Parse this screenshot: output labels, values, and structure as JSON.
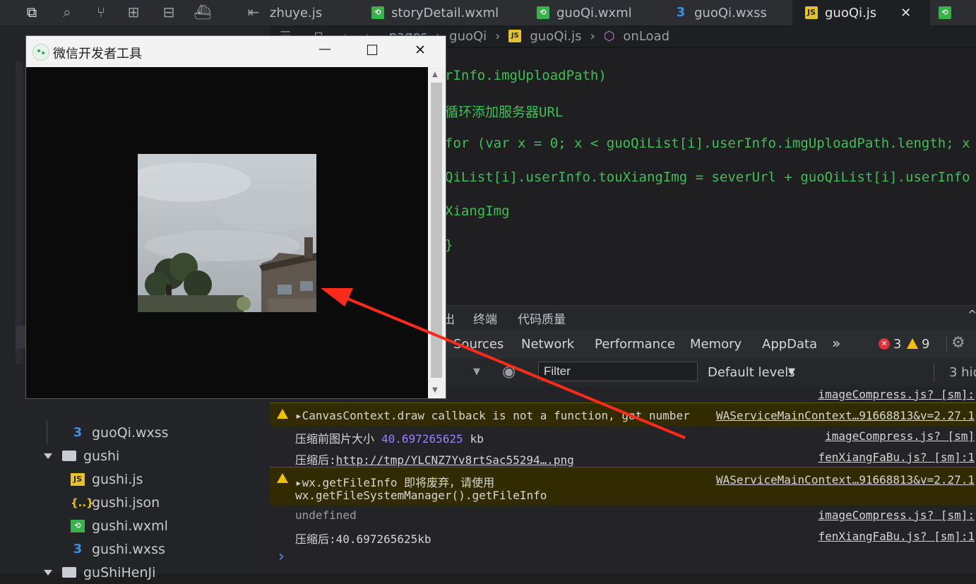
{
  "tabs": [
    {
      "label": "zhuye.js",
      "icon": "js"
    },
    {
      "label": "storyDetail.wxml",
      "icon": "wxml"
    },
    {
      "label": "guoQi.wxml",
      "icon": "wxml"
    },
    {
      "label": "guoQi.wxss",
      "icon": "wxss"
    },
    {
      "label": "guoQi.js",
      "icon": "js",
      "active": true
    }
  ],
  "close_glyph": "✕",
  "breadcrumb": [
    "pages",
    "guoQi",
    "guoQi.js",
    "onLoad"
  ],
  "code_lines": [
    "rInfo.imgUploadPath)",
    "循环添加服务器URL",
    "for (var x = 0; x < guoQiList[i].userInfo.imgUploadPath.length; x",
    "QiList[i].userInfo.touXiangImg = severUrl + guoQiList[i].userInfo",
    "XiangImg",
    "}"
  ],
  "sidebar": [
    {
      "label": "guoQi.wxss",
      "type": "wxss",
      "indent": 2
    },
    {
      "label": "gushi",
      "type": "folder",
      "indent": 1
    },
    {
      "label": "gushi.js",
      "type": "js",
      "indent": 2
    },
    {
      "label": "gushi.json",
      "type": "json",
      "indent": 2
    },
    {
      "label": "gushi.wxml",
      "type": "wxml",
      "indent": 2
    },
    {
      "label": "gushi.wxss",
      "type": "wxss",
      "indent": 2
    },
    {
      "label": "guShiHenJi",
      "type": "folder",
      "indent": 1
    }
  ],
  "panel_tabs": [
    "出",
    "终端",
    "代码质量"
  ],
  "devtools_tabs": [
    "Sources",
    "Network",
    "Performance",
    "Memory",
    "AppData"
  ],
  "more_glyph": "»",
  "error_count": "3",
  "warning_count": "9",
  "filter_placeholder": "Filter",
  "levels_label": "Default levels",
  "hidden_label": "3 hid",
  "console": [
    {
      "type": "log",
      "msg": "",
      "src": "imageCompress.js? [sm]:"
    },
    {
      "type": "warn",
      "msg": "▸CanvasContext.draw callback is not a function, got number",
      "src": "WAServiceMainContext…91668813&v=2.27.1"
    },
    {
      "type": "log",
      "msg": "压缩前图片大小",
      "num": "40.697265625",
      "suffix": "kb",
      "src": "imageCompress.js? [sm]"
    },
    {
      "type": "log",
      "msg": "压缩后:",
      "link": "http://tmp/YLCNZ7Yv8rtSac55294….png",
      "src": "fenXiangFaBu.js? [sm]:1"
    },
    {
      "type": "warn",
      "msg": "▸wx.getFileInfo 即将废弃，请使用",
      "msg2": "wx.getFileSystemManager().getFileInfo",
      "src": "WAServiceMainContext…91668813&v=2.27.1"
    },
    {
      "type": "log",
      "msg": "undefined",
      "dim": true,
      "src": "imageCompress.js? [sm]:"
    },
    {
      "type": "log",
      "msg": "压缩后:40.697265625kb",
      "src": "fenXiangFaBu.js? [sm]:1"
    }
  ],
  "prompt_glyph": "›",
  "window": {
    "title": "微信开发者工具",
    "min": "—",
    "max": "☐",
    "close": "✕",
    "scroll_up": "▲",
    "scroll_down": "▼"
  },
  "colors": {
    "accent_arrow": "#ff2a1a",
    "warning": "#f2c200",
    "error": "#e0303a",
    "code_green": "#3fbf55"
  }
}
